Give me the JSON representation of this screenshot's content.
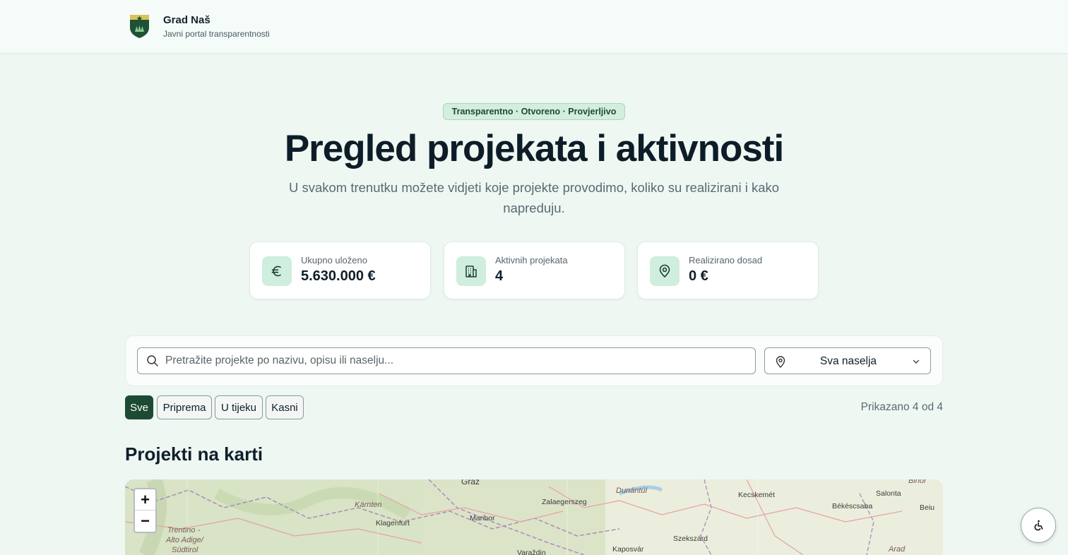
{
  "header": {
    "name": "Grad Naš",
    "subtitle": "Javni portal transparentnosti"
  },
  "hero": {
    "pill": "Transparentno · Otvoreno · Provjerljivo",
    "title": "Pregled projekata i aktivnosti",
    "subtitle": "U svakom trenutku možete vidjeti koje projekte provodimo, koliko su realizirani i kako napreduju."
  },
  "stats": [
    {
      "label": "Ukupno uloženo",
      "value": "5.630.000 €",
      "icon": "euro-icon"
    },
    {
      "label": "Aktivnih projekata",
      "value": "4",
      "icon": "building-icon"
    },
    {
      "label": "Realizirano dosad",
      "value": "0 €",
      "icon": "map-pin-icon"
    }
  ],
  "search": {
    "placeholder": "Pretražite projekte po nazivu, opisu ili naselju...",
    "settlement_value": "Sva naselja"
  },
  "filters": [
    {
      "label": "Sve",
      "active": true
    },
    {
      "label": "Priprema",
      "active": false
    },
    {
      "label": "U tijeku",
      "active": false
    },
    {
      "label": "Kasni",
      "active": false
    }
  ],
  "shown_text": "Prikazano 4 od 4",
  "map": {
    "title": "Projekti na karti",
    "zoom_in": "+",
    "zoom_out": "−",
    "labels": {
      "graz": "Graz",
      "karnten": "Kärnten",
      "klagenfurt": "Klagenfurt",
      "trentino": "Trentino -",
      "alto_adige": "Alto Adige/",
      "sudtirol": "Südtirol",
      "maribor": "Maribor",
      "varazdin": "Varaždin",
      "zalaegerszeg": "Zalaegerszeg",
      "dunantul": "Dunántúl",
      "kaposvar": "Kaposvár",
      "szekszard": "Szekszárd",
      "kecskemet": "Kecskemét",
      "bekescsaba": "Békéscsaba",
      "salonta": "Salonta",
      "bihor": "Bihor",
      "beiu": "Beiu",
      "arad": "Arad"
    }
  },
  "colors": {
    "background": "#eef7f2",
    "accent": "#1d4a33",
    "pill_bg": "#d3eedd",
    "icon_bg": "#cfeedd"
  }
}
